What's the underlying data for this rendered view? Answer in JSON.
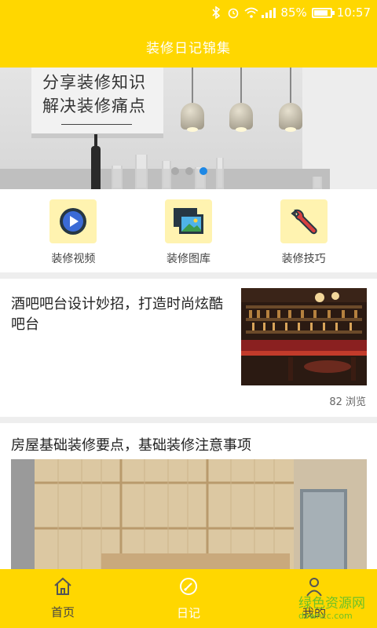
{
  "status_bar": {
    "battery": "85%",
    "time": "10:57"
  },
  "header": {
    "title": "装修日记锦集"
  },
  "banner": {
    "line1": "分享装修知识",
    "line2": "解决装修痛点",
    "active_dot": 3,
    "dot_count": 3
  },
  "categories": [
    {
      "label": "装修视频",
      "icon": "play-video-icon"
    },
    {
      "label": "装修图库",
      "icon": "gallery-icon"
    },
    {
      "label": "装修技巧",
      "icon": "wrench-icon"
    }
  ],
  "articles": [
    {
      "title": "酒吧吧台设计妙招，打造时尚炫酷吧台",
      "views": "82 浏览"
    },
    {
      "title": "房屋基础装修要点，基础装修注意事项"
    }
  ],
  "bottom_nav": [
    {
      "label": "首页",
      "icon": "home-icon",
      "active": false
    },
    {
      "label": "日记",
      "icon": "diary-icon",
      "active": true
    },
    {
      "label": "我的",
      "icon": "user-icon",
      "active": false
    }
  ],
  "watermark": {
    "text": "绿色资源网",
    "sub": "downcc.com"
  },
  "colors": {
    "primary": "#ffd700",
    "active_dot": "#1e88e5"
  }
}
